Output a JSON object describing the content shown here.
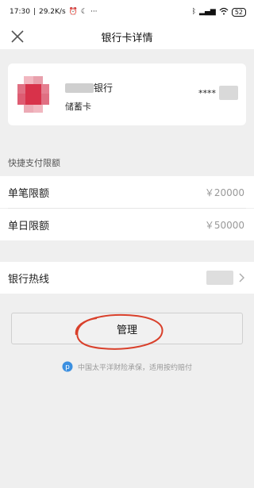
{
  "status_bar": {
    "time": "17:30",
    "network_speed": "29.2K/s",
    "battery": "52"
  },
  "header": {
    "title": "银行卡详情",
    "close_icon": "close-icon"
  },
  "card": {
    "bank_name_suffix": "银行",
    "card_type": "储蓄卡",
    "masked_prefix": "****"
  },
  "limits": {
    "section_title": "快捷支付限额",
    "single_label": "单笔限额",
    "single_value": "￥20000",
    "daily_label": "单日限额",
    "daily_value": "￥50000"
  },
  "hotline": {
    "label": "银行热线",
    "chevron_icon": "chevron-right-icon"
  },
  "manage": {
    "label": "管理"
  },
  "footer": {
    "note": "中国太平洋财险承保，适用按约赔付",
    "icon": "shield-p-icon"
  },
  "colors": {
    "annotation_red": "#d9402b",
    "logo_red": "#d8324a"
  }
}
